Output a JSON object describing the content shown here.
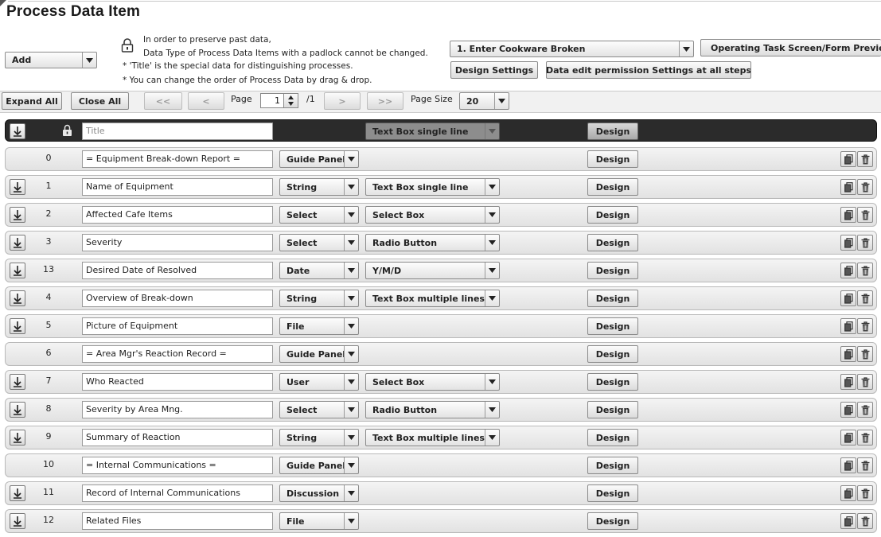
{
  "page": {
    "title": "Process Data Item"
  },
  "add_button": {
    "label": "Add"
  },
  "notes": {
    "line1": "In order to preserve past data,",
    "line2": "Data Type of Process Data Items with a padlock cannot be changed.",
    "line3": "* 'Title' is the special data for distinguishing processes.",
    "line4": "* You can change the order of Process Data by drag & drop."
  },
  "step_select": {
    "value": "1. Enter Cookware Broken"
  },
  "buttons": {
    "preview": "Operating Task Screen/Form Preview",
    "design_settings": "Design Settings",
    "permission": "Data edit permission Settings at all steps"
  },
  "toolbar": {
    "expand_all": "Expand All",
    "close_all": "Close All",
    "first": "<<",
    "prev": "<",
    "page_label": "Page",
    "page_value": "1",
    "page_total": "/1",
    "next": ">",
    "last": ">>",
    "page_size_label": "Page Size",
    "page_size_value": "20"
  },
  "header_row": {
    "placeholder": "Title",
    "format": "Text Box single line",
    "design": "Design"
  },
  "rows": [
    {
      "num": "0",
      "name": "= Equipment Break-down Report =",
      "type": "Guide Panel",
      "format": "",
      "design": "Design",
      "drag": false
    },
    {
      "num": "1",
      "name": "Name of Equipment",
      "type": "String",
      "format": "Text Box single line",
      "design": "Design",
      "drag": true
    },
    {
      "num": "2",
      "name": "Affected Cafe Items",
      "type": "Select",
      "format": "Select Box",
      "design": "Design",
      "drag": true
    },
    {
      "num": "3",
      "name": "Severity",
      "type": "Select",
      "format": "Radio Button",
      "design": "Design",
      "drag": true
    },
    {
      "num": "13",
      "name": "Desired Date of Resolved",
      "type": "Date",
      "format": "Y/M/D",
      "design": "Design",
      "drag": true
    },
    {
      "num": "4",
      "name": "Overview of Break-down",
      "type": "String",
      "format": "Text Box multiple lines",
      "design": "Design",
      "drag": true
    },
    {
      "num": "5",
      "name": "Picture of Equipment",
      "type": "File",
      "format": "",
      "design": "Design",
      "drag": true
    },
    {
      "num": "6",
      "name": "= Area Mgr's Reaction Record =",
      "type": "Guide Panel",
      "format": "",
      "design": "Design",
      "drag": false
    },
    {
      "num": "7",
      "name": "Who Reacted",
      "type": "User",
      "format": "Select Box",
      "design": "Design",
      "drag": true
    },
    {
      "num": "8",
      "name": "Severity by Area Mng.",
      "type": "Select",
      "format": "Radio Button",
      "design": "Design",
      "drag": true
    },
    {
      "num": "9",
      "name": "Summary of Reaction",
      "type": "String",
      "format": "Text Box multiple lines",
      "design": "Design",
      "drag": true
    },
    {
      "num": "10",
      "name": "= Internal Communications =",
      "type": "Guide Panel",
      "format": "",
      "design": "Design",
      "drag": false
    },
    {
      "num": "11",
      "name": "Record of Internal Communications",
      "type": "Discussion",
      "format": "",
      "design": "Design",
      "drag": true
    },
    {
      "num": "12",
      "name": "Related Files",
      "type": "File",
      "format": "",
      "design": "Design",
      "drag": true
    }
  ]
}
